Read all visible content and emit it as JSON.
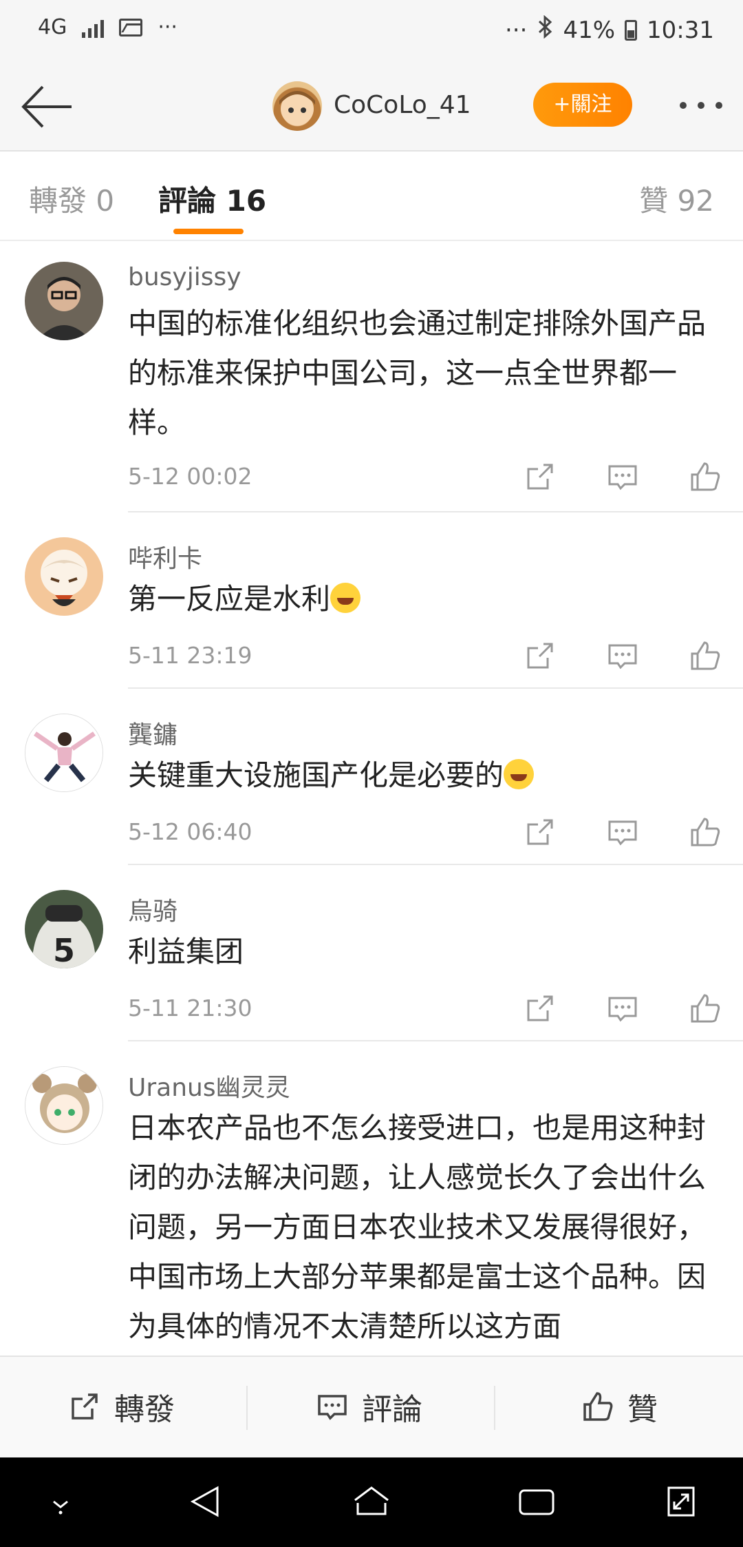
{
  "status_bar": {
    "network": "4G",
    "more": "···",
    "extra": "···",
    "battery": "41%",
    "time": "10:31"
  },
  "header": {
    "username": "CoCoLo_41",
    "follow_label": "+關注"
  },
  "tabs": {
    "repost": "轉發 0",
    "comment": "評論 16",
    "like": "贊 92"
  },
  "comments": [
    {
      "name": "busyjissy",
      "text": "中国的标准化组织也会通过制定排除外国产品的标准来保护中国公司，这一点全世界都一样。",
      "time": "5-12 00:02"
    },
    {
      "name": "哔利卡",
      "text": "第一反应是水利",
      "time": "5-11 23:19"
    },
    {
      "name": "龔鏞",
      "text": "关键重大设施国产化是必要的",
      "time": "5-12 06:40"
    },
    {
      "name": "烏骑",
      "text": "利益集团",
      "time": "5-11 21:30"
    },
    {
      "name": "Uranus幽灵灵",
      "text": "日本农产品也不怎么接受进口，也是用这种封闭的办法解决问题，让人感觉长久了会出什么问题，另一方面日本农业技术又发展得很好，中国市场上大部分苹果都是富士这个品种。因为具体的情况不太清楚所以这方面",
      "time": ""
    }
  ],
  "bottom_bar": {
    "repost": "轉發",
    "comment": "評論",
    "like": "贊"
  },
  "colors": {
    "accent": "#ff8200",
    "text_primary": "#222222",
    "text_secondary": "#999999"
  }
}
